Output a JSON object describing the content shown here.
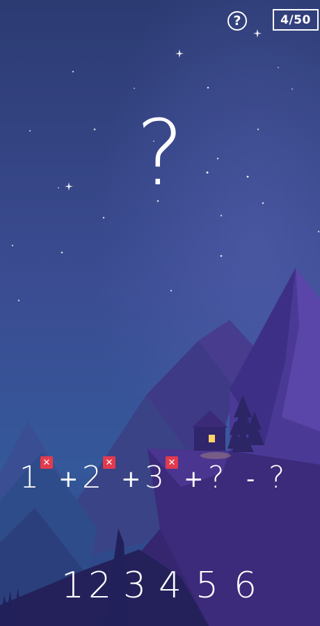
{
  "hud": {
    "help_glyph": "?",
    "level": "4/50"
  },
  "puzzle": {
    "answer_placeholder": "?",
    "equation": [
      {
        "kind": "num",
        "text": "1",
        "marked_wrong": true
      },
      {
        "kind": "op",
        "text": "+"
      },
      {
        "kind": "num",
        "text": "2",
        "marked_wrong": true
      },
      {
        "kind": "op",
        "text": "+"
      },
      {
        "kind": "num",
        "text": "3",
        "marked_wrong": true
      },
      {
        "kind": "op",
        "text": "+"
      },
      {
        "kind": "num",
        "text": "?",
        "marked_wrong": false
      },
      {
        "kind": "op",
        "text": "-"
      },
      {
        "kind": "num",
        "text": "?",
        "marked_wrong": false
      }
    ],
    "wrong_mark_glyph": "✕"
  },
  "keypad": {
    "digits": [
      "1",
      "2",
      "3",
      "4",
      "5",
      "6"
    ]
  },
  "colors": {
    "sky_top": "#2e3d74",
    "sky_bottom": "#3d4f95",
    "mountain_dark": "#3a2570",
    "window_light": "#ffd36a",
    "error_badge": "#e23b4d"
  }
}
